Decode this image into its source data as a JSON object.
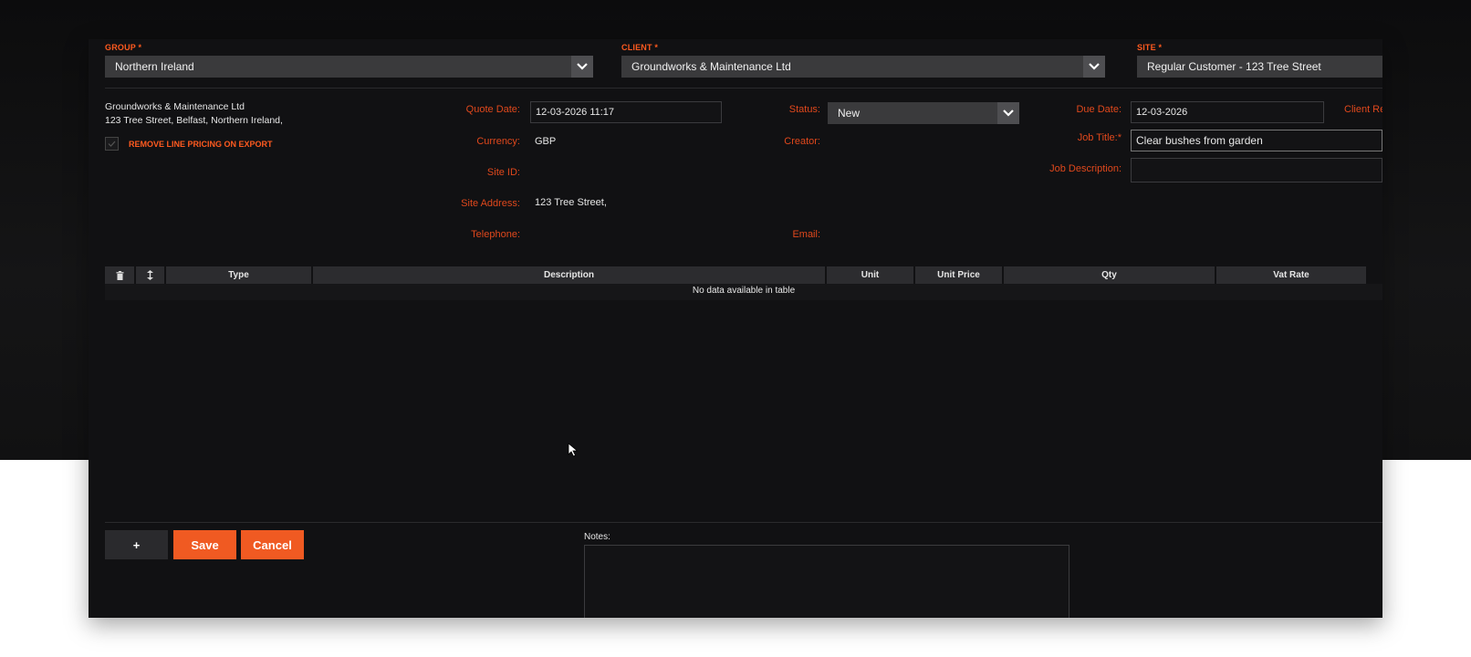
{
  "header": {
    "group": {
      "label": "GROUP *",
      "value": "Northern Ireland"
    },
    "client": {
      "label": "CLIENT *",
      "value": "Groundworks & Maintenance Ltd"
    },
    "site": {
      "label": "SITE *",
      "value": "Regular Customer - 123 Tree Street"
    }
  },
  "client_info": {
    "name": "Groundworks & Maintenance Ltd",
    "address": "123 Tree Street, Belfast, Northern Ireland,",
    "remove_pricing_label": "REMOVE LINE PRICING ON EXPORT"
  },
  "details": {
    "quote_date_label": "Quote Date:",
    "quote_date": "12-03-2026 11:17",
    "currency_label": "Currency:",
    "currency": "GBP",
    "site_id_label": "Site ID:",
    "site_address_label": "Site Address:",
    "site_address": "123 Tree Street,",
    "telephone_label": "Telephone:",
    "status_label": "Status:",
    "status": "New",
    "creator_label": "Creator:",
    "email_label": "Email:",
    "due_date_label": "Due Date:",
    "due_date": "12-03-2026",
    "client_ref_label": "Client Re",
    "job_title_label": "Job Title:*",
    "job_title": "Clear bushes from garden",
    "job_description_label": "Job Description:"
  },
  "table": {
    "columns": [
      "Type",
      "Description",
      "Unit",
      "Unit Price",
      "Qty",
      "Vat Rate"
    ],
    "empty_message": "No data available in table"
  },
  "footer": {
    "add_label": "+",
    "save_label": "Save",
    "cancel_label": "Cancel",
    "notes_label": "Notes:"
  },
  "colors": {
    "accent": "#f05a22",
    "label": "#e0481c",
    "panel": "#111113"
  }
}
